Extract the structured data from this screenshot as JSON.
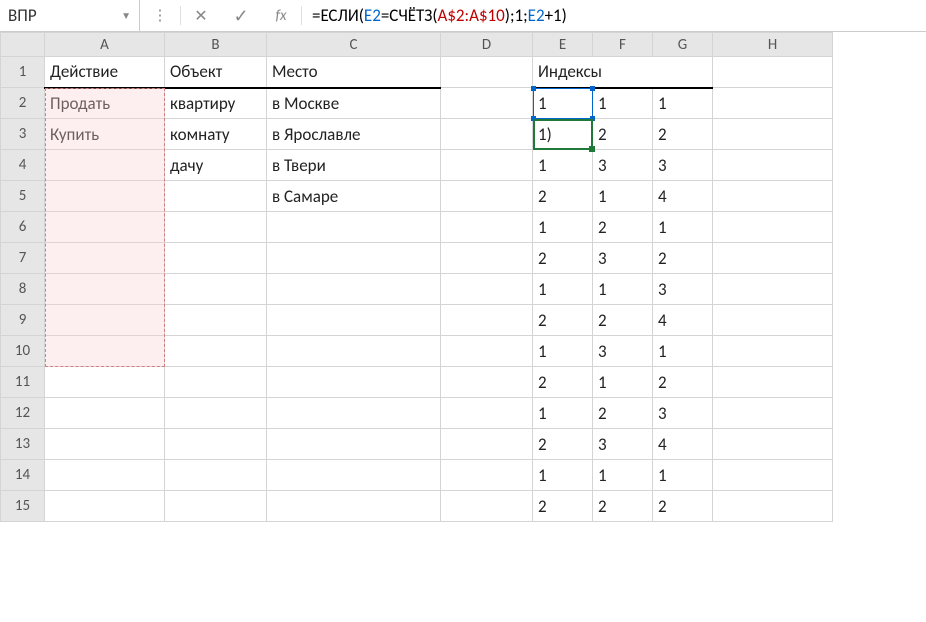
{
  "name_box": "ВПР",
  "formula": {
    "tokens": [
      {
        "t": "=ЕСЛИ(",
        "c": "tk-black"
      },
      {
        "t": "E2",
        "c": "tk-blue"
      },
      {
        "t": "=СЧЁТЗ(",
        "c": "tk-black"
      },
      {
        "t": "A$2:A$10",
        "c": "tk-red"
      },
      {
        "t": ");1;",
        "c": "tk-black"
      },
      {
        "t": "E2",
        "c": "tk-blue"
      },
      {
        "t": "+1)",
        "c": "tk-black"
      }
    ]
  },
  "columns": [
    "A",
    "B",
    "C",
    "D",
    "E",
    "F",
    "G",
    "H"
  ],
  "row_headers": [
    1,
    2,
    3,
    4,
    5,
    6,
    7,
    8,
    9,
    10,
    11,
    12,
    13,
    14,
    15
  ],
  "headers": {
    "A": "Действие",
    "B": "Объект",
    "C": "Место",
    "EFG": "Индексы"
  },
  "cells": {
    "A2": "Продать",
    "A3": "Купить",
    "B2": "квартиру",
    "B3": "комнату",
    "B4": "дачу",
    "C2": "в Москве",
    "C3": "в Ярославле",
    "C4": "в Твери",
    "C5": "в Самаре",
    "E2": "1",
    "F2": "1",
    "G2": "1",
    "E3": "1)",
    "F3": "2",
    "G3": "2",
    "E4": "1",
    "F4": "3",
    "G4": "3",
    "E5": "2",
    "F5": "1",
    "G5": "4",
    "E6": "1",
    "F6": "2",
    "G6": "1",
    "E7": "2",
    "F7": "3",
    "G7": "2",
    "E8": "1",
    "F8": "1",
    "G8": "3",
    "E9": "2",
    "F9": "2",
    "G9": "4",
    "E10": "1",
    "F10": "3",
    "G10": "1",
    "E11": "2",
    "F11": "1",
    "G11": "2",
    "E12": "1",
    "F12": "2",
    "G12": "3",
    "E13": "2",
    "F13": "3",
    "G13": "4",
    "E14": "1",
    "F14": "1",
    "G14": "1",
    "E15": "2",
    "F15": "2",
    "G15": "2"
  },
  "chart_data": {
    "type": "table",
    "title": "Индексы",
    "columns_left": [
      "Действие",
      "Объект",
      "Место"
    ],
    "rows_left": [
      [
        "Продать",
        "квартиру",
        "в Москве"
      ],
      [
        "Купить",
        "комнату",
        "в Ярославле"
      ],
      [
        "",
        "дачу",
        "в Твери"
      ],
      [
        "",
        "",
        "в Самаре"
      ]
    ],
    "index_matrix": [
      [
        1,
        1,
        1
      ],
      [
        null,
        2,
        2
      ],
      [
        1,
        3,
        3
      ],
      [
        2,
        1,
        4
      ],
      [
        1,
        2,
        1
      ],
      [
        2,
        3,
        2
      ],
      [
        1,
        1,
        3
      ],
      [
        2,
        2,
        4
      ],
      [
        1,
        3,
        1
      ],
      [
        2,
        1,
        2
      ],
      [
        1,
        2,
        3
      ],
      [
        2,
        3,
        4
      ],
      [
        1,
        1,
        1
      ],
      [
        2,
        2,
        2
      ]
    ]
  }
}
